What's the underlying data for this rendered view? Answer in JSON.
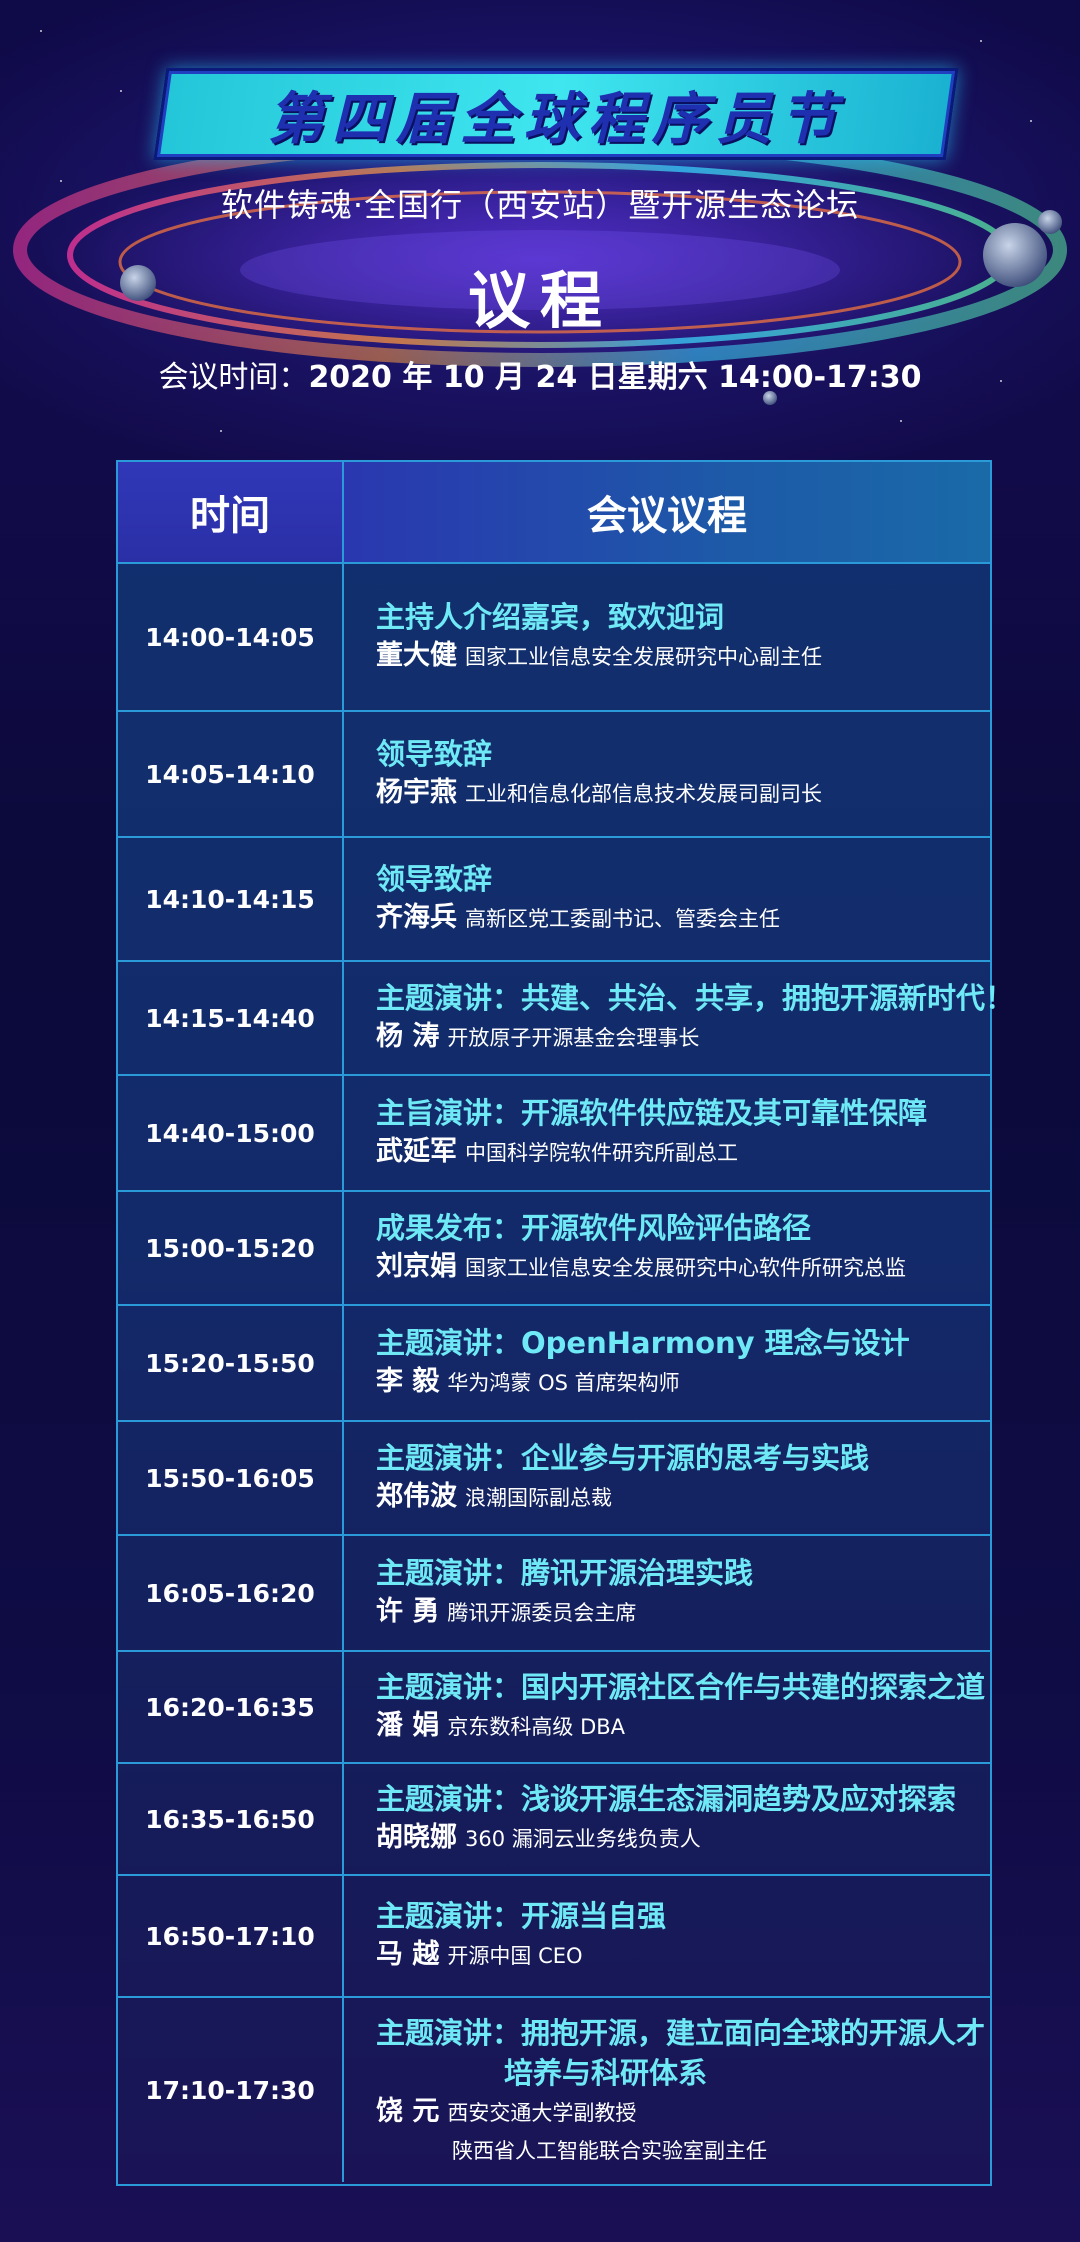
{
  "header": {
    "event_title": "第四届全球程序员节",
    "subtitle": "软件铸魂·全国行（西安站）暨开源生态论坛",
    "agenda_word": "议程",
    "time_label": "会议时间：",
    "time_value": "2020 年 10 月 24 日星期六 14:00-17:30"
  },
  "table": {
    "col_time": "时间",
    "col_agenda": "会议议程",
    "rows": [
      {
        "time": "14:00-14:05",
        "topic": "主持人介绍嘉宾，致欢迎词",
        "speaker": "董大健",
        "role": "国家工业信息安全发展研究中心副主任"
      },
      {
        "time": "14:05-14:10",
        "topic": "领导致辞",
        "speaker": "杨宇燕",
        "role": "工业和信息化部信息技术发展司副司长"
      },
      {
        "time": "14:10-14:15",
        "topic": "领导致辞",
        "speaker": "齐海兵",
        "role": "高新区党工委副书记、管委会主任"
      },
      {
        "time": "14:15-14:40",
        "topic": "主题演讲：共建、共治、共享，拥抱开源新时代！",
        "speaker": "杨 涛",
        "role": "开放原子开源基金会理事长"
      },
      {
        "time": "14:40-15:00",
        "topic": "主旨演讲：开源软件供应链及其可靠性保障",
        "speaker": "武延军",
        "role": "中国科学院软件研究所副总工"
      },
      {
        "time": "15:00-15:20",
        "topic": "成果发布：开源软件风险评估路径",
        "speaker": "刘京娟",
        "role": "国家工业信息安全发展研究中心软件所研究总监"
      },
      {
        "time": "15:20-15:50",
        "topic": "主题演讲：OpenHarmony 理念与设计",
        "speaker": "李 毅",
        "role": "华为鸿蒙 OS 首席架构师"
      },
      {
        "time": "15:50-16:05",
        "topic": "主题演讲：企业参与开源的思考与实践",
        "speaker": "郑伟波",
        "role": "浪潮国际副总裁"
      },
      {
        "time": "16:05-16:20",
        "topic": "主题演讲：腾讯开源治理实践",
        "speaker": "许 勇",
        "role": "腾讯开源委员会主席"
      },
      {
        "time": "16:20-16:35",
        "topic": "主题演讲：国内开源社区合作与共建的探索之道",
        "speaker": "潘 娟",
        "role": "京东数科高级 DBA"
      },
      {
        "time": "16:35-16:50",
        "topic": "主题演讲：浅谈开源生态漏洞趋势及应对探索",
        "speaker": "胡晓娜",
        "role": "360 漏洞云业务线负责人"
      },
      {
        "time": "16:50-17:10",
        "topic": "主题演讲：开源当自强",
        "speaker": "马 越",
        "role": "开源中国 CEO"
      },
      {
        "time": "17:10-17:30",
        "topic": "主题演讲：拥抱开源，建立面向全球的开源人才",
        "topic2": "培养与科研体系",
        "speaker": "饶 元",
        "role": "西安交通大学副教授",
        "role2": "陕西省人工智能联合实验室副主任"
      }
    ]
  }
}
